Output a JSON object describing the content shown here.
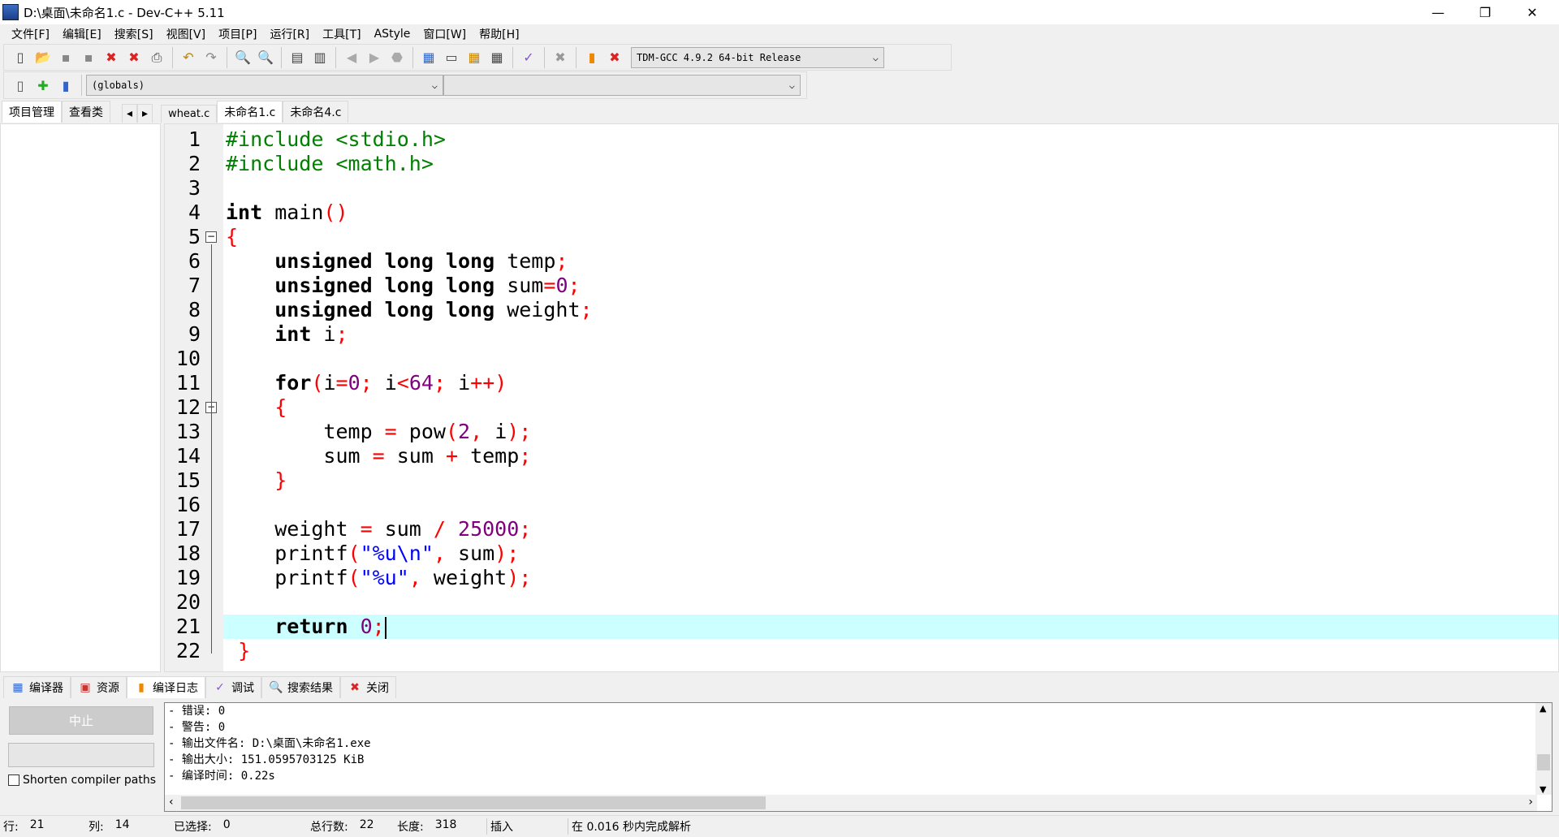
{
  "window": {
    "title": "D:\\桌面\\未命名1.c - Dev-C++ 5.11",
    "minimize": "—",
    "restore": "❐",
    "close": "✕"
  },
  "menu": [
    "文件[F]",
    "编辑[E]",
    "搜索[S]",
    "视图[V]",
    "项目[P]",
    "运行[R]",
    "工具[T]",
    "AStyle",
    "窗口[W]",
    "帮助[H]"
  ],
  "toolbar": {
    "icons": [
      "new-file-icon",
      "open-icon",
      "save-icon",
      "save-all-icon",
      "close-icon",
      "close-all-icon",
      "print-icon",
      "undo-icon",
      "redo-icon",
      "find-icon",
      "replace-icon",
      "indent-icon",
      "unindent-icon",
      "back-icon",
      "forward-icon",
      "goto-icon",
      "compile-icon",
      "run-icon",
      "compile-run-icon",
      "rebuild-icon",
      "check-icon",
      "stop-icon",
      "chart-icon",
      "profile-delete-icon"
    ],
    "compiler": "TDM-GCC 4.9.2 64-bit Release",
    "scope": "(globals)",
    "member": ""
  },
  "side_tabs": [
    "项目管理",
    "查看类"
  ],
  "file_tabs": [
    {
      "label": "wheat.c",
      "active": false
    },
    {
      "label": "未命名1.c",
      "active": true
    },
    {
      "label": "未命名4.c",
      "active": false
    }
  ],
  "editor": {
    "current_line": 21,
    "lines": [
      [
        [
          "pp",
          "#include <stdio.h>"
        ]
      ],
      [
        [
          "pp",
          "#include <math.h>"
        ]
      ],
      [],
      [
        [
          "kw",
          "int"
        ],
        [
          "id",
          " main"
        ],
        [
          "sym",
          "()"
        ]
      ],
      [
        [
          "sym",
          "{"
        ]
      ],
      [
        [
          "id",
          "    "
        ],
        [
          "kw",
          "unsigned long long"
        ],
        [
          "id",
          " temp"
        ],
        [
          "sym",
          ";"
        ]
      ],
      [
        [
          "id",
          "    "
        ],
        [
          "kw",
          "unsigned long long"
        ],
        [
          "id",
          " sum"
        ],
        [
          "sym",
          "="
        ],
        [
          "num",
          "0"
        ],
        [
          "sym",
          ";"
        ]
      ],
      [
        [
          "id",
          "    "
        ],
        [
          "kw",
          "unsigned long long"
        ],
        [
          "id",
          " weight"
        ],
        [
          "sym",
          ";"
        ]
      ],
      [
        [
          "id",
          "    "
        ],
        [
          "kw",
          "int"
        ],
        [
          "id",
          " i"
        ],
        [
          "sym",
          ";"
        ]
      ],
      [],
      [
        [
          "id",
          "    "
        ],
        [
          "kw",
          "for"
        ],
        [
          "sym",
          "("
        ],
        [
          "id",
          "i"
        ],
        [
          "sym",
          "="
        ],
        [
          "num",
          "0"
        ],
        [
          "sym",
          ";"
        ],
        [
          "id",
          " i"
        ],
        [
          "sym",
          "<"
        ],
        [
          "num",
          "64"
        ],
        [
          "sym",
          ";"
        ],
        [
          "id",
          " i"
        ],
        [
          "sym",
          "++)"
        ]
      ],
      [
        [
          "id",
          "    "
        ],
        [
          "sym",
          "{"
        ]
      ],
      [
        [
          "id",
          "        temp "
        ],
        [
          "sym",
          "="
        ],
        [
          "id",
          " pow"
        ],
        [
          "sym",
          "("
        ],
        [
          "num",
          "2"
        ],
        [
          "sym",
          ","
        ],
        [
          "id",
          " i"
        ],
        [
          "sym",
          ");"
        ]
      ],
      [
        [
          "id",
          "        sum "
        ],
        [
          "sym",
          "="
        ],
        [
          "id",
          " sum "
        ],
        [
          "sym",
          "+"
        ],
        [
          "id",
          " temp"
        ],
        [
          "sym",
          ";"
        ]
      ],
      [
        [
          "id",
          "    "
        ],
        [
          "sym",
          "}"
        ]
      ],
      [],
      [
        [
          "id",
          "    weight "
        ],
        [
          "sym",
          "="
        ],
        [
          "id",
          " sum "
        ],
        [
          "sym",
          "/"
        ],
        [
          "num",
          " 25000"
        ],
        [
          "sym",
          ";"
        ]
      ],
      [
        [
          "id",
          "    printf"
        ],
        [
          "sym",
          "("
        ],
        [
          "str",
          "\"%u\\n\""
        ],
        [
          "sym",
          ","
        ],
        [
          "id",
          " sum"
        ],
        [
          "sym",
          ");"
        ]
      ],
      [
        [
          "id",
          "    printf"
        ],
        [
          "sym",
          "("
        ],
        [
          "str",
          "\"%u\""
        ],
        [
          "sym",
          ","
        ],
        [
          "id",
          " weight"
        ],
        [
          "sym",
          ");"
        ]
      ],
      [],
      [
        [
          "id",
          "    "
        ],
        [
          "kw",
          "return"
        ],
        [
          "num",
          " 0"
        ],
        [
          "sym",
          ";"
        ]
      ],
      [
        [
          "id",
          " "
        ],
        [
          "sym",
          "}"
        ]
      ]
    ]
  },
  "bottom_tabs": [
    {
      "label": "编译器",
      "icon": "grid-icon",
      "active": false
    },
    {
      "label": "资源",
      "icon": "resources-icon",
      "active": false
    },
    {
      "label": "编译日志",
      "icon": "chart-icon",
      "active": true
    },
    {
      "label": "调试",
      "icon": "check-icon",
      "active": false
    },
    {
      "label": "搜索结果",
      "icon": "search-icon",
      "active": false
    },
    {
      "label": "关闭",
      "icon": "close-icon",
      "active": false
    }
  ],
  "compile": {
    "stop": "中止",
    "shorten": "Shorten compiler paths",
    "shorten_checked": false,
    "log": [
      "- 错误: 0",
      "- 警告: 0",
      "- 输出文件名: D:\\桌面\\未命名1.exe",
      "- 输出大小: 151.0595703125 KiB",
      "- 编译时间: 0.22s"
    ]
  },
  "status": {
    "row_label": "行:",
    "row": "21",
    "col_label": "列:",
    "col": "14",
    "sel_label": "已选择:",
    "sel": "0",
    "total_label": "总行数:",
    "total": "22",
    "len_label": "长度:",
    "len": "318",
    "mode": "插入",
    "parse": "在 0.016 秒内完成解析"
  },
  "colors": {
    "keyword": "#000000",
    "preprocessor": "#008000",
    "symbol": "#ff0000",
    "number": "#800080",
    "string": "#0000ff",
    "current_line": "#ccffff"
  }
}
